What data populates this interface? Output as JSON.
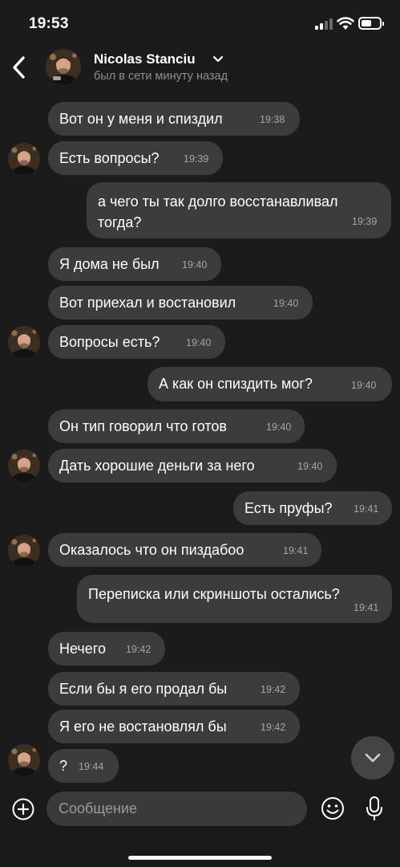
{
  "status_bar": {
    "time": "19:53"
  },
  "header": {
    "contact_name": "Nicolas Stanciu",
    "contact_status": "был в сети минуту назад"
  },
  "messages": [
    {
      "dir": "in",
      "text": "Вот он у меня и спиздил",
      "time": "19:38"
    },
    {
      "dir": "in",
      "text": "Есть вопросы?",
      "time": "19:39"
    },
    {
      "dir": "out",
      "text": "а чего ты так долго восстанавливал тогда?",
      "time": "19:39"
    },
    {
      "dir": "in",
      "text": "Я дома не был",
      "time": "19:40"
    },
    {
      "dir": "in",
      "text": "Вот приехал и востановил",
      "time": "19:40"
    },
    {
      "dir": "in",
      "text": "Вопросы есть?",
      "time": "19:40"
    },
    {
      "dir": "out",
      "text": "А как он спиздить мог?",
      "time": "19:40"
    },
    {
      "dir": "in",
      "text": "Он тип говорил что готов",
      "time": "19:40"
    },
    {
      "dir": "in",
      "text": "Дать хорошие деньги за него",
      "time": "19:40"
    },
    {
      "dir": "out",
      "text": "Есть пруфы?",
      "time": "19:41"
    },
    {
      "dir": "in",
      "text": "Оказалось что он пиздабоо",
      "time": "19:41"
    },
    {
      "dir": "out",
      "text": "Переписка или скриншоты остались?",
      "time": "19:41"
    },
    {
      "dir": "in",
      "text": "Нечего",
      "time": "19:42"
    },
    {
      "dir": "in",
      "text": "Если бы я его продал бы",
      "time": "19:42"
    },
    {
      "dir": "in",
      "text": "Я его не востановлял бы",
      "time": "19:42"
    },
    {
      "dir": "in",
      "text": "?",
      "time": "19:44"
    }
  ],
  "composer": {
    "placeholder": "Сообщение"
  },
  "icons": {
    "back": "chevron-left-icon",
    "name_dropdown": "chevron-down-icon",
    "scroll_down": "chevron-down-icon",
    "attach": "plus-circle-icon",
    "emoji": "smiley-icon",
    "voice": "microphone-icon"
  },
  "colors": {
    "background": "#1b1b1b",
    "bubble": "#3c3c3c",
    "secondary_text": "#8e8e8e",
    "timestamp": "#a5a5a5"
  }
}
